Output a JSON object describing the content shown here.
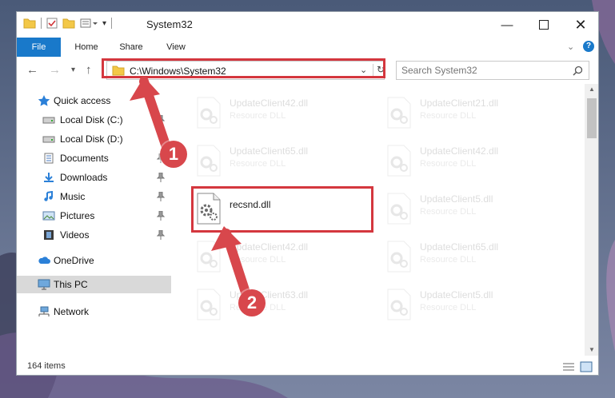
{
  "window": {
    "title": "System32"
  },
  "ribbon": {
    "tabs": [
      "File",
      "Home",
      "Share",
      "View"
    ]
  },
  "address": {
    "path": "C:\\Windows\\System32"
  },
  "search": {
    "placeholder": "Search System32"
  },
  "sidebar": {
    "items": [
      {
        "label": "Quick access",
        "icon": "star-icon"
      },
      {
        "label": "Local Disk (C:)",
        "icon": "drive-icon"
      },
      {
        "label": "Local Disk (D:)",
        "icon": "drive-icon"
      },
      {
        "label": "Documents",
        "icon": "documents-icon"
      },
      {
        "label": "Downloads",
        "icon": "download-icon"
      },
      {
        "label": "Music",
        "icon": "music-icon"
      },
      {
        "label": "Pictures",
        "icon": "pictures-icon"
      },
      {
        "label": "Videos",
        "icon": "videos-icon"
      },
      {
        "label": "OneDrive",
        "icon": "cloud-icon"
      },
      {
        "label": "This PC",
        "icon": "computer-icon"
      },
      {
        "label": "Network",
        "icon": "network-icon"
      }
    ]
  },
  "files": [
    {
      "name": "UpdateClient42.dll",
      "type": "Resource DLL"
    },
    {
      "name": "UpdateClient21.dll",
      "type": "Resource DLL"
    },
    {
      "name": "UpdateClient65.dll",
      "type": "Resource DLL"
    },
    {
      "name": "UpdateClient42.dll",
      "type": "Resource DLL"
    },
    {
      "name": "recsnd.dll",
      "type": ""
    },
    {
      "name": "UpdateClient5.dll",
      "type": "Resource DLL"
    },
    {
      "name": "UpdateClient42.dll",
      "type": "Resource DLL"
    },
    {
      "name": "UpdateClient65.dll",
      "type": "Resource DLL"
    },
    {
      "name": "UpdateClient63.dll",
      "type": "Resource DLL"
    },
    {
      "name": "UpdateClient5.dll",
      "type": "Resource DLL"
    }
  ],
  "status": {
    "item_count": "164 items"
  },
  "annotations": {
    "step1": "1",
    "step2": "2"
  },
  "colors": {
    "accent": "#1979ca",
    "highlight": "#d4373e",
    "badge": "#d8474c"
  }
}
